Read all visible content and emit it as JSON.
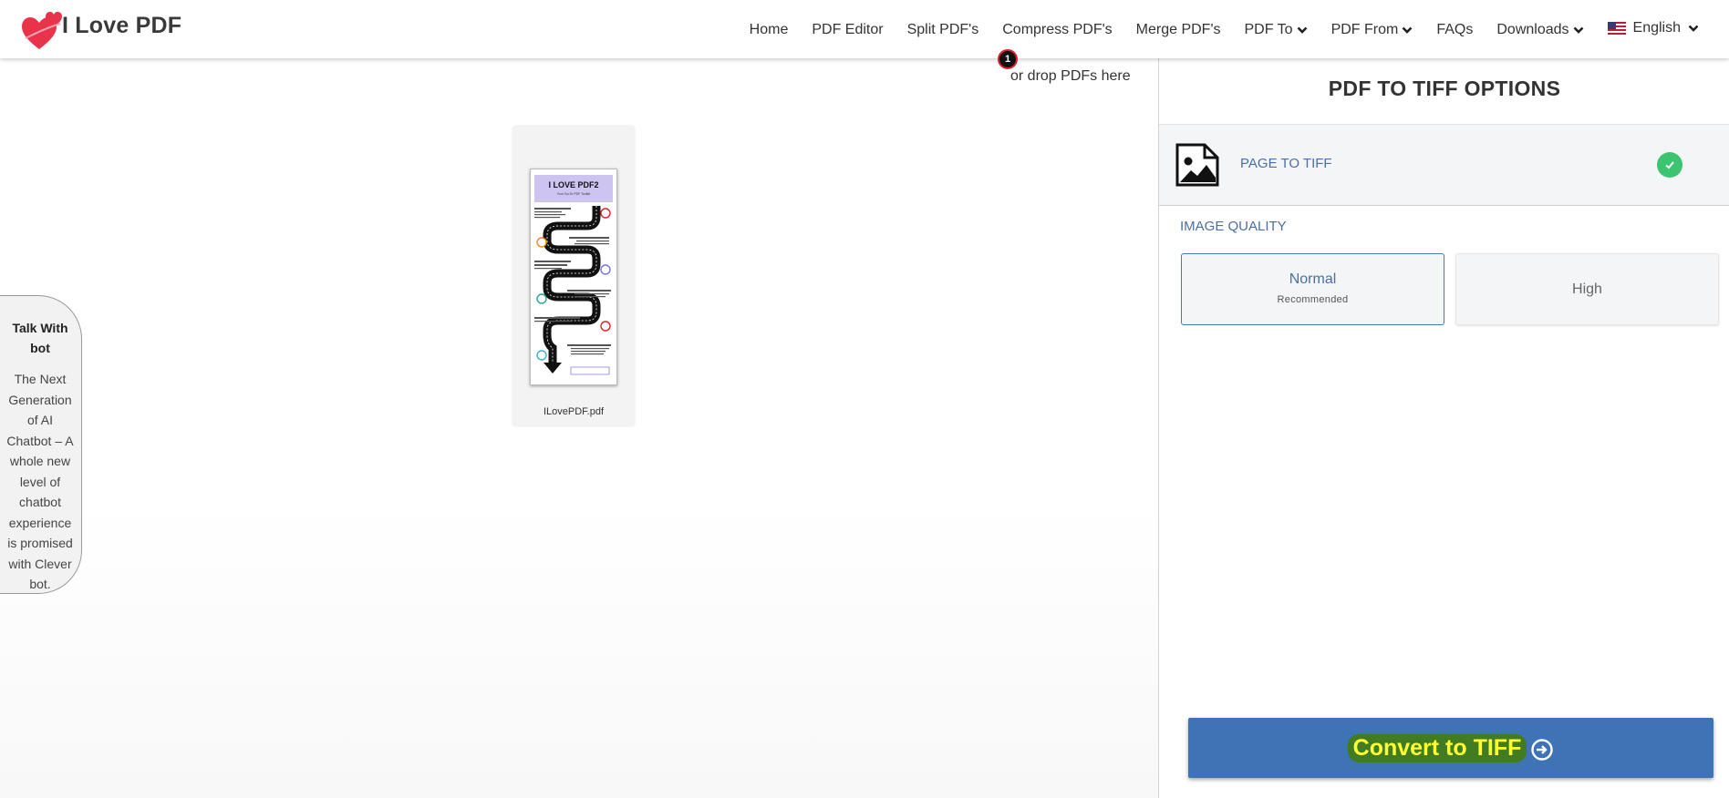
{
  "header": {
    "logo_text": "I Love PDF",
    "nav": [
      {
        "label": "Home"
      },
      {
        "label": "PDF Editor"
      },
      {
        "label": "Split PDF's"
      },
      {
        "label": "Compress PDF's"
      },
      {
        "label": "Merge PDF's"
      },
      {
        "label": "PDF To"
      },
      {
        "label": "PDF From"
      },
      {
        "label": "FAQs"
      },
      {
        "label": "Downloads"
      }
    ],
    "language": "English"
  },
  "workspace": {
    "file_count": "1",
    "drop_text": "or drop PDFs here",
    "file": {
      "name": "ILovePDF.pdf",
      "thumb_title": "I LOVE PDF2",
      "thumb_subtitle": "Your Go-To PDF Toolkit"
    }
  },
  "chatbot": {
    "title": "Talk With bot",
    "description": "The Next Generation of AI Chatbot – A whole new level of chatbot experience is promised with Clever bot."
  },
  "panel": {
    "title": "PDF TO TIFF OPTIONS",
    "option": {
      "label": "PAGE TO TIFF"
    },
    "quality_label": "IMAGE QUALITY",
    "quality_options": [
      {
        "title": "Normal",
        "subtitle": "Recommended"
      },
      {
        "title": "High"
      }
    ],
    "convert_label": "Convert to TIFF"
  },
  "colors": {
    "accent_blue": "#3e73b5",
    "link_blue": "#4a6fa5",
    "success_green": "#3cc470",
    "badge_red": "#e0202a"
  },
  "icons": [
    "heart-logo-icon",
    "chevron-down-icon",
    "us-flag-icon",
    "image-file-icon",
    "check-icon",
    "arrow-circle-right-icon"
  ]
}
